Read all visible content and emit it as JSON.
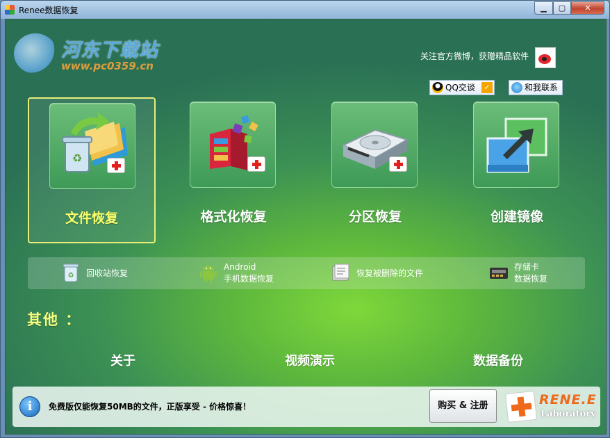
{
  "window": {
    "title": "Renee数据恢复",
    "controls": [
      "minimize",
      "maximize",
      "close"
    ]
  },
  "watermark": {
    "site_name": "河东下载站",
    "url": "www.pc0359.cn"
  },
  "header": {
    "follow_text": "关注官方微博，获赠精品软件",
    "qq_label": "QQ交谈",
    "contact_label": "和我联系"
  },
  "modes": [
    {
      "label": "文件恢复",
      "icon": "recycle-bin-folder-icon",
      "selected": true
    },
    {
      "label": "格式化恢复",
      "icon": "defrag-blocks-icon",
      "selected": false
    },
    {
      "label": "分区恢复",
      "icon": "hard-drive-icon",
      "selected": false
    },
    {
      "label": "创建镜像",
      "icon": "disk-image-icon",
      "selected": false
    }
  ],
  "quick_links": [
    {
      "lines": [
        "回收站恢复"
      ],
      "icon": "recycle-bin-icon"
    },
    {
      "lines": [
        "Android",
        "手机数据恢复"
      ],
      "icon": "android-icon"
    },
    {
      "lines": [
        "恢复被删除的文件"
      ],
      "icon": "deleted-file-icon"
    },
    {
      "lines": [
        "存储卡",
        "数据恢复"
      ],
      "icon": "memory-card-icon"
    }
  ],
  "other": {
    "heading": "其他 ：",
    "links": [
      "关于",
      "视频演示",
      "数据备份"
    ]
  },
  "footer": {
    "message": "免费版仅能恢复50MB的文件，正版享受 - 价格惊喜！",
    "buy_label": "购买 & 注册",
    "brand_name": "RENE.E",
    "brand_sub": "Laboratory"
  },
  "colors": {
    "selected_label": "#fbff6a",
    "other_heading": "#f6ff7e",
    "brand_orange": "#ee6a1a",
    "background_green": "#3c9154"
  }
}
